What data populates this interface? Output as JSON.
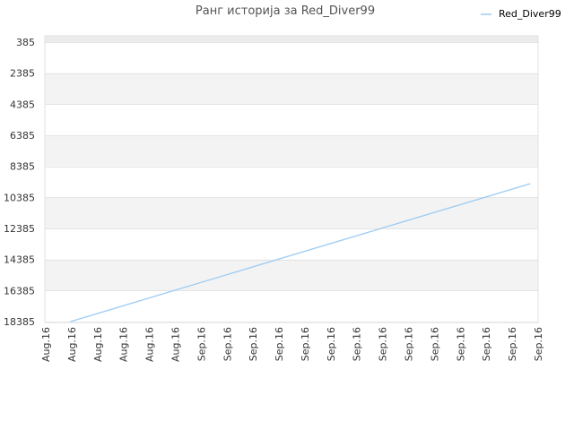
{
  "chart_data": {
    "type": "line",
    "title": "Ранг историја за Red_Diver99",
    "legend": {
      "placement": "top-right",
      "items": [
        "Red_Diver99"
      ]
    },
    "y_axis": {
      "reversed": true,
      "range": [
        385,
        18385
      ],
      "ticks": [
        "385",
        "2385",
        "4385",
        "6385",
        "8385",
        "10385",
        "12385",
        "14385",
        "16385",
        "18385"
      ]
    },
    "x_axis": {
      "ticks": [
        "Aug.16",
        "Aug.16",
        "Aug.16",
        "Aug.16",
        "Aug.16",
        "Aug.16",
        "Sep.16",
        "Sep.16",
        "Sep.16",
        "Sep.16",
        "Sep.16",
        "Sep.16",
        "Sep.16",
        "Sep.16",
        "Sep.16",
        "Sep.16",
        "Sep.16",
        "Sep.16",
        "Sep.16",
        "Sep.16"
      ]
    },
    "series": [
      {
        "name": "Red_Diver99",
        "color": "#9ccbf2",
        "x_index": [
          0.95,
          18.7
        ],
        "values": [
          18385,
          9500
        ]
      }
    ],
    "band_colors": [
      "#ffffff",
      "#f3f3f3"
    ],
    "top_band_color": "#ececec",
    "grid": true
  }
}
